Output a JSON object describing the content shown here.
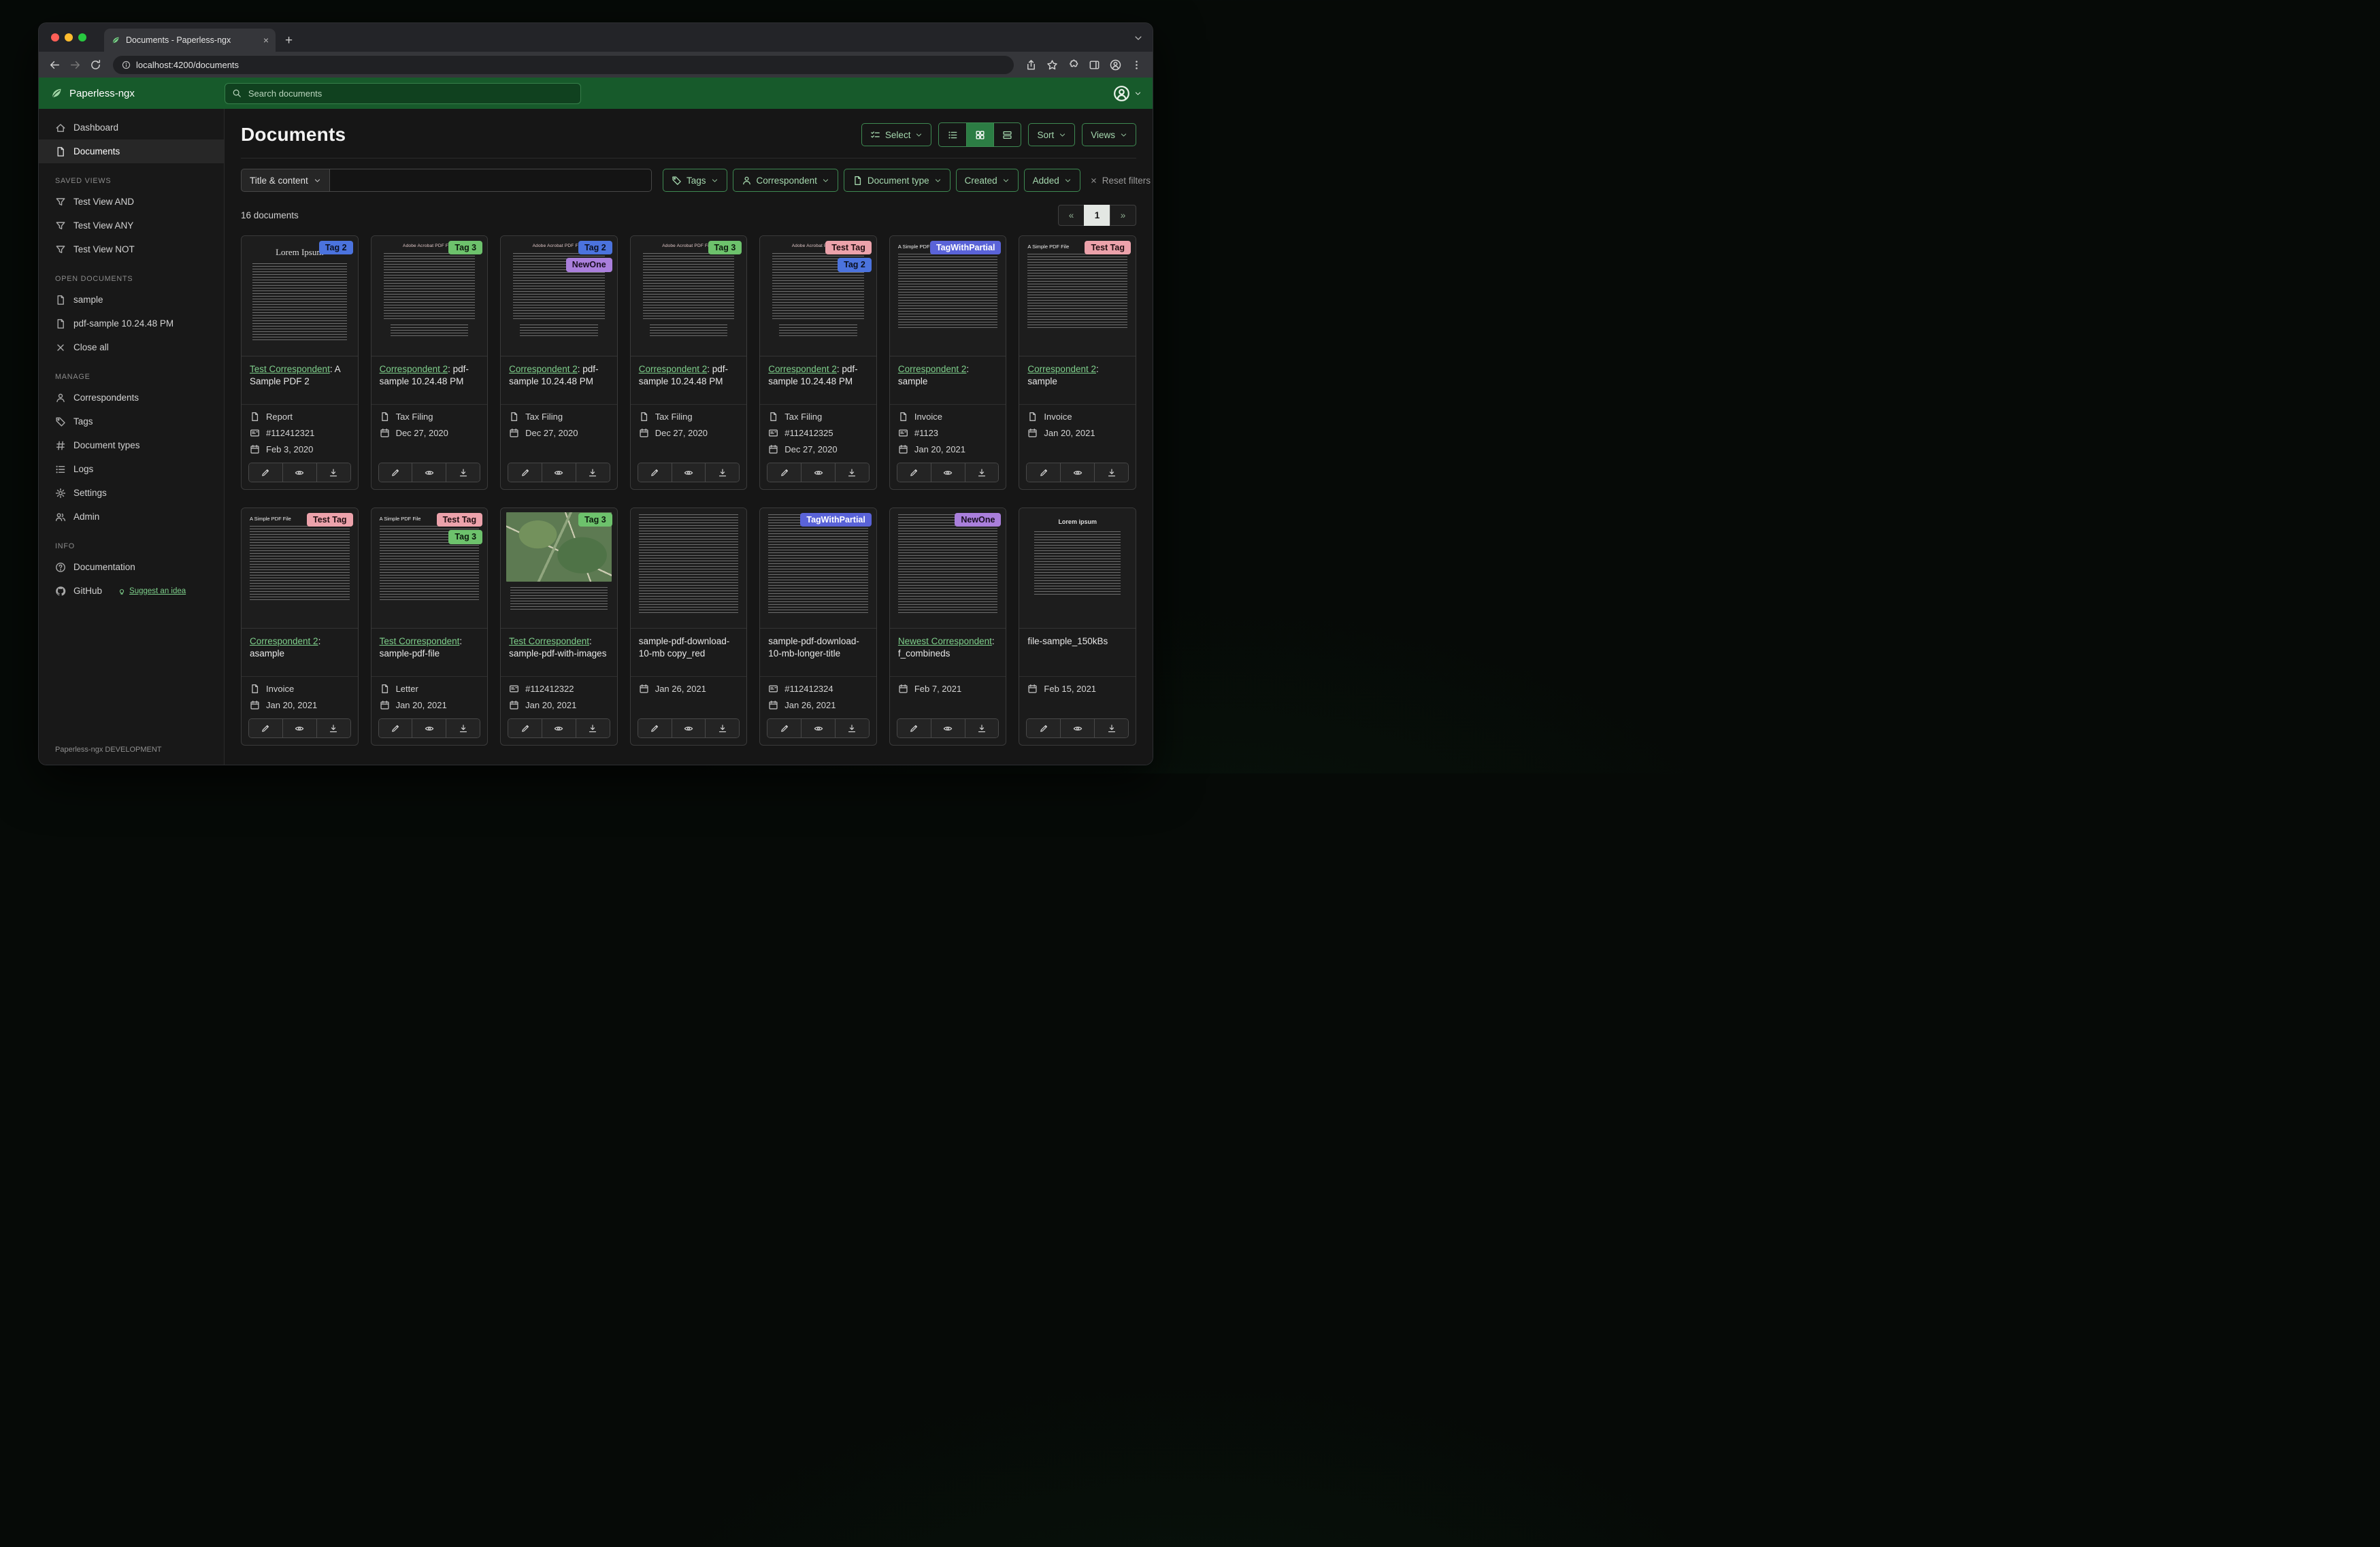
{
  "colors": {
    "header_green": "#175a2b",
    "link_green": "#7ecf8b",
    "pagination_active_bg": "#e3e7e3"
  },
  "browser": {
    "tab_title": "Documents - Paperless-ngx",
    "tab_close_glyph": "×",
    "new_tab_glyph": "+",
    "url": "localhost:4200/documents"
  },
  "header": {
    "app_name": "Paperless-ngx",
    "search_placeholder": "Search documents"
  },
  "sidebar": {
    "primary": [
      {
        "label": "Dashboard",
        "icon": "home"
      },
      {
        "label": "Documents",
        "icon": "doc",
        "active": true
      }
    ],
    "sections": [
      {
        "title": "SAVED VIEWS",
        "items": [
          {
            "label": "Test View AND",
            "icon": "funnel"
          },
          {
            "label": "Test View ANY",
            "icon": "funnel"
          },
          {
            "label": "Test View NOT",
            "icon": "funnel"
          }
        ]
      },
      {
        "title": "OPEN DOCUMENTS",
        "items": [
          {
            "label": "sample",
            "icon": "doc"
          },
          {
            "label": "pdf-sample 10.24.48 PM",
            "icon": "doc"
          },
          {
            "label": "Close all",
            "icon": "x"
          }
        ]
      },
      {
        "title": "MANAGE",
        "items": [
          {
            "label": "Correspondents",
            "icon": "person"
          },
          {
            "label": "Tags",
            "icon": "tag"
          },
          {
            "label": "Document types",
            "icon": "hash"
          },
          {
            "label": "Logs",
            "icon": "listul"
          },
          {
            "label": "Settings",
            "icon": "gear"
          },
          {
            "label": "Admin",
            "icon": "users"
          }
        ]
      },
      {
        "title": "INFO",
        "items": [
          {
            "label": "Documentation",
            "icon": "question"
          },
          {
            "label": "GitHub",
            "icon": "github",
            "extra": {
              "label": "Suggest an idea",
              "icon": "bulb"
            }
          }
        ]
      }
    ],
    "footer": "Paperless-ngx DEVELOPMENT"
  },
  "main": {
    "title": "Documents",
    "select_label": "Select",
    "sort_label": "Sort",
    "views_label": "Views"
  },
  "filters": {
    "field_label": "Title & content",
    "input_value": "",
    "buttons": [
      {
        "label": "Tags",
        "icon": "tag"
      },
      {
        "label": "Correspondent",
        "icon": "person"
      },
      {
        "label": "Document type",
        "icon": "doc"
      },
      {
        "label": "Created"
      },
      {
        "label": "Added"
      }
    ],
    "reset_label": "Reset filters"
  },
  "results": {
    "count": "16 documents",
    "pagination": {
      "prev": "«",
      "current": "1",
      "next": "»"
    }
  },
  "tag_defs": {
    "Tag 2": {
      "bg": "#4b73de",
      "fg": "#0b1020"
    },
    "Tag 3": {
      "bg": "#6dc26c",
      "fg": "#0c1a0d"
    },
    "NewOne": {
      "bg": "#aa7fdc",
      "fg": "#170d20"
    },
    "Test Tag": {
      "bg": "#eca2ab",
      "fg": "#200d11"
    },
    "TagWithPartial": {
      "bg": "#5a63d8",
      "fg": "#ffffff"
    }
  },
  "cards": [
    {
      "tags": [
        "Tag 2"
      ],
      "thumb": "lorem",
      "thumb_heading": "Lorem Ipsum",
      "link": "Test Correspondent",
      "rest": ": A Sample PDF 2",
      "type": "Report",
      "asn": "#112412321",
      "date": "Feb 3, 2020"
    },
    {
      "tags": [
        "Tag 3"
      ],
      "thumb": "pdfguide",
      "thumb_heading": "Adobe Acrobat PDF Files",
      "link": "Correspondent 2",
      "rest": ": pdf-sample 10.24.48 PM",
      "type": "Tax Filing",
      "date": "Dec 27, 2020"
    },
    {
      "tags": [
        "Tag 2",
        "NewOne"
      ],
      "thumb": "pdfguide",
      "thumb_heading": "Adobe Acrobat PDF Files",
      "link": "Correspondent 2",
      "rest": ": pdf-sample 10.24.48 PM",
      "type": "Tax Filing",
      "date": "Dec 27, 2020"
    },
    {
      "tags": [
        "Tag 3"
      ],
      "thumb": "pdfguide",
      "thumb_heading": "Adobe Acrobat PDF Files",
      "link": "Correspondent 2",
      "rest": ": pdf-sample 10.24.48 PM",
      "type": "Tax Filing",
      "date": "Dec 27, 2020"
    },
    {
      "tags": [
        "Test Tag",
        "Tag 2"
      ],
      "thumb": "pdfguide",
      "thumb_heading": "Adobe Acrobat PDF Files",
      "link": "Correspondent 2",
      "rest": ": pdf-sample 10.24.48 PM",
      "type": "Tax Filing",
      "asn": "#112412325",
      "date": "Dec 27, 2020"
    },
    {
      "tags": [
        "TagWithPartial"
      ],
      "thumb": "simple",
      "thumb_heading": "A Simple PDF File",
      "link": "Correspondent 2",
      "rest": ": sample",
      "type": "Invoice",
      "asn": "#1123",
      "date": "Jan 20, 2021"
    },
    {
      "tags": [
        "Test Tag"
      ],
      "thumb": "simple",
      "thumb_heading": "A Simple PDF File",
      "link": "Correspondent 2",
      "rest": ": sample",
      "type": "Invoice",
      "date": "Jan 20, 2021"
    },
    {
      "tags": [
        "Test Tag"
      ],
      "thumb": "simple",
      "thumb_heading": "A Simple PDF File",
      "link": "Correspondent 2",
      "rest": ": asample",
      "type": "Invoice",
      "date": "Jan 20, 2021"
    },
    {
      "tags": [
        "Test Tag",
        "Tag 3"
      ],
      "thumb": "simple",
      "thumb_heading": "A Simple PDF File",
      "link": "Test Correspondent",
      "rest": ": sample-pdf-file",
      "type": "Letter",
      "date": "Jan 20, 2021"
    },
    {
      "tags": [
        "Tag 3"
      ],
      "thumb": "map",
      "link": "Test Correspondent",
      "rest": ": sample-pdf-with-images",
      "asn": "#112412322",
      "date": "Jan 20, 2021"
    },
    {
      "tags": [],
      "thumb": "dense",
      "title": "sample-pdf-download-10-mb copy_red",
      "date": "Jan 26, 2021"
    },
    {
      "tags": [
        "TagWithPartial"
      ],
      "thumb": "dense",
      "title": "sample-pdf-download-10-mb-longer-title",
      "asn": "#112412324",
      "date": "Jan 26, 2021"
    },
    {
      "tags": [
        "NewOne"
      ],
      "thumb": "dense",
      "link": "Newest Correspondent",
      "rest": ": f_combineds",
      "date": "Feb 7, 2021"
    },
    {
      "tags": [],
      "thumb": "loremcenter",
      "thumb_heading": "Lorem ipsum",
      "title": "file-sample_150kBs",
      "date": "Feb 15, 2021"
    }
  ]
}
